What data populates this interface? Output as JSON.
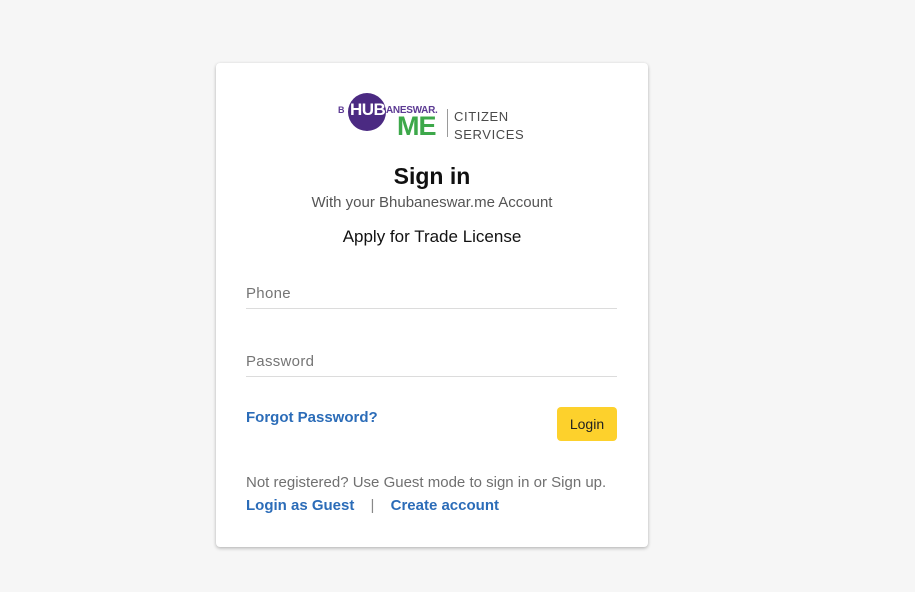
{
  "logo": {
    "b": "B",
    "hub": "HUB",
    "aneswar": "ANESWAR.",
    "me": "ME",
    "citizen": "CITIZEN",
    "services": "SERVICES"
  },
  "header": {
    "title": "Sign in",
    "subtitle": "With your Bhubaneswar.me Account",
    "purpose": "Apply for Trade License"
  },
  "form": {
    "phone_placeholder": "Phone",
    "phone_value": "",
    "password_placeholder": "Password",
    "password_value": "",
    "forgot_label": "Forgot Password?",
    "login_label": "Login"
  },
  "footer": {
    "note": "Not registered? Use Guest mode to sign in or Sign up.",
    "guest_label": "Login as Guest",
    "separator": "|",
    "create_label": "Create account"
  },
  "colors": {
    "background": "#f6f6f6",
    "link": "#2b6cb8",
    "login_button": "#fdd12c",
    "logo_purple": "#4b2a82",
    "logo_green": "#3da84a"
  }
}
